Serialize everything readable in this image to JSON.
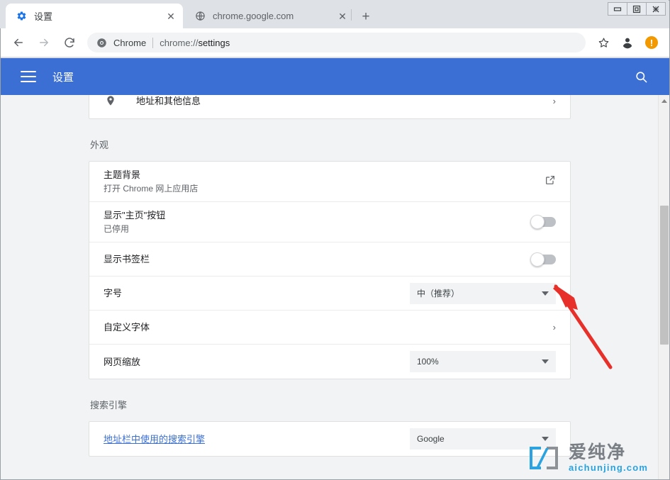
{
  "window": {
    "controls": [
      {
        "name": "minimize",
        "glyph": "▭"
      },
      {
        "name": "maximize",
        "glyph": "❐"
      },
      {
        "name": "close",
        "glyph": "✕"
      }
    ]
  },
  "tabs": [
    {
      "title": "设置",
      "favicon": "gear-icon",
      "active": true,
      "close_glyph": "✕"
    },
    {
      "title": "chrome.google.com",
      "favicon": "globe-icon",
      "active": false,
      "close_glyph": "✕"
    }
  ],
  "newtab_glyph": "+",
  "toolbar": {
    "back_glyph": "←",
    "forward_glyph": "→",
    "reload_glyph": "⟳",
    "omnibox": {
      "chip": "Chrome",
      "url_prefix": "chrome://",
      "url_bold": "settings"
    },
    "bookmark_glyph": "☆",
    "profile_name": "profile-avatar",
    "alert_glyph": "!"
  },
  "settings_header": {
    "title": "设置",
    "menu_name": "hamburger-menu",
    "search_name": "search-icon"
  },
  "content": {
    "top_card": {
      "rows": [
        {
          "icon": "location-pin-icon",
          "title": "地址和其他信息",
          "end_type": "chevron",
          "end_glyph": "›"
        }
      ]
    },
    "appearance": {
      "heading": "外观",
      "rows": [
        {
          "title": "主题背景",
          "subtitle": "打开 Chrome 网上应用店",
          "end_type": "external-link",
          "end_glyph": "↗"
        },
        {
          "title": "显示\"主页\"按钮",
          "subtitle": "已停用",
          "end_type": "toggle",
          "toggle_on": false
        },
        {
          "title": "显示书签栏",
          "subtitle": "",
          "end_type": "toggle",
          "toggle_on": false
        },
        {
          "title": "字号",
          "subtitle": "",
          "end_type": "select",
          "select_value": "中（推荐）"
        },
        {
          "title": "自定义字体",
          "subtitle": "",
          "end_type": "chevron",
          "end_glyph": "›"
        },
        {
          "title": "网页缩放",
          "subtitle": "",
          "end_type": "select",
          "select_value": "100%"
        }
      ]
    },
    "search_engine": {
      "heading": "搜索引擎",
      "rows": [
        {
          "title": "地址栏中使用的搜索引擎",
          "is_link": true,
          "end_type": "select",
          "select_value": "Google"
        }
      ]
    }
  },
  "scrollbar": {
    "up_arrow": "scroll-up-arrow"
  },
  "annotation": {
    "arrow_color": "#e8302a",
    "points_at": "显示书签栏"
  },
  "watermark": {
    "cn": "爱纯净",
    "en": "aichunjing.com"
  },
  "colors": {
    "accent_blue": "#3b6fd4",
    "alert_orange": "#f29900",
    "arrow_red": "#e8302a",
    "content_bg": "#f1f3f4"
  }
}
